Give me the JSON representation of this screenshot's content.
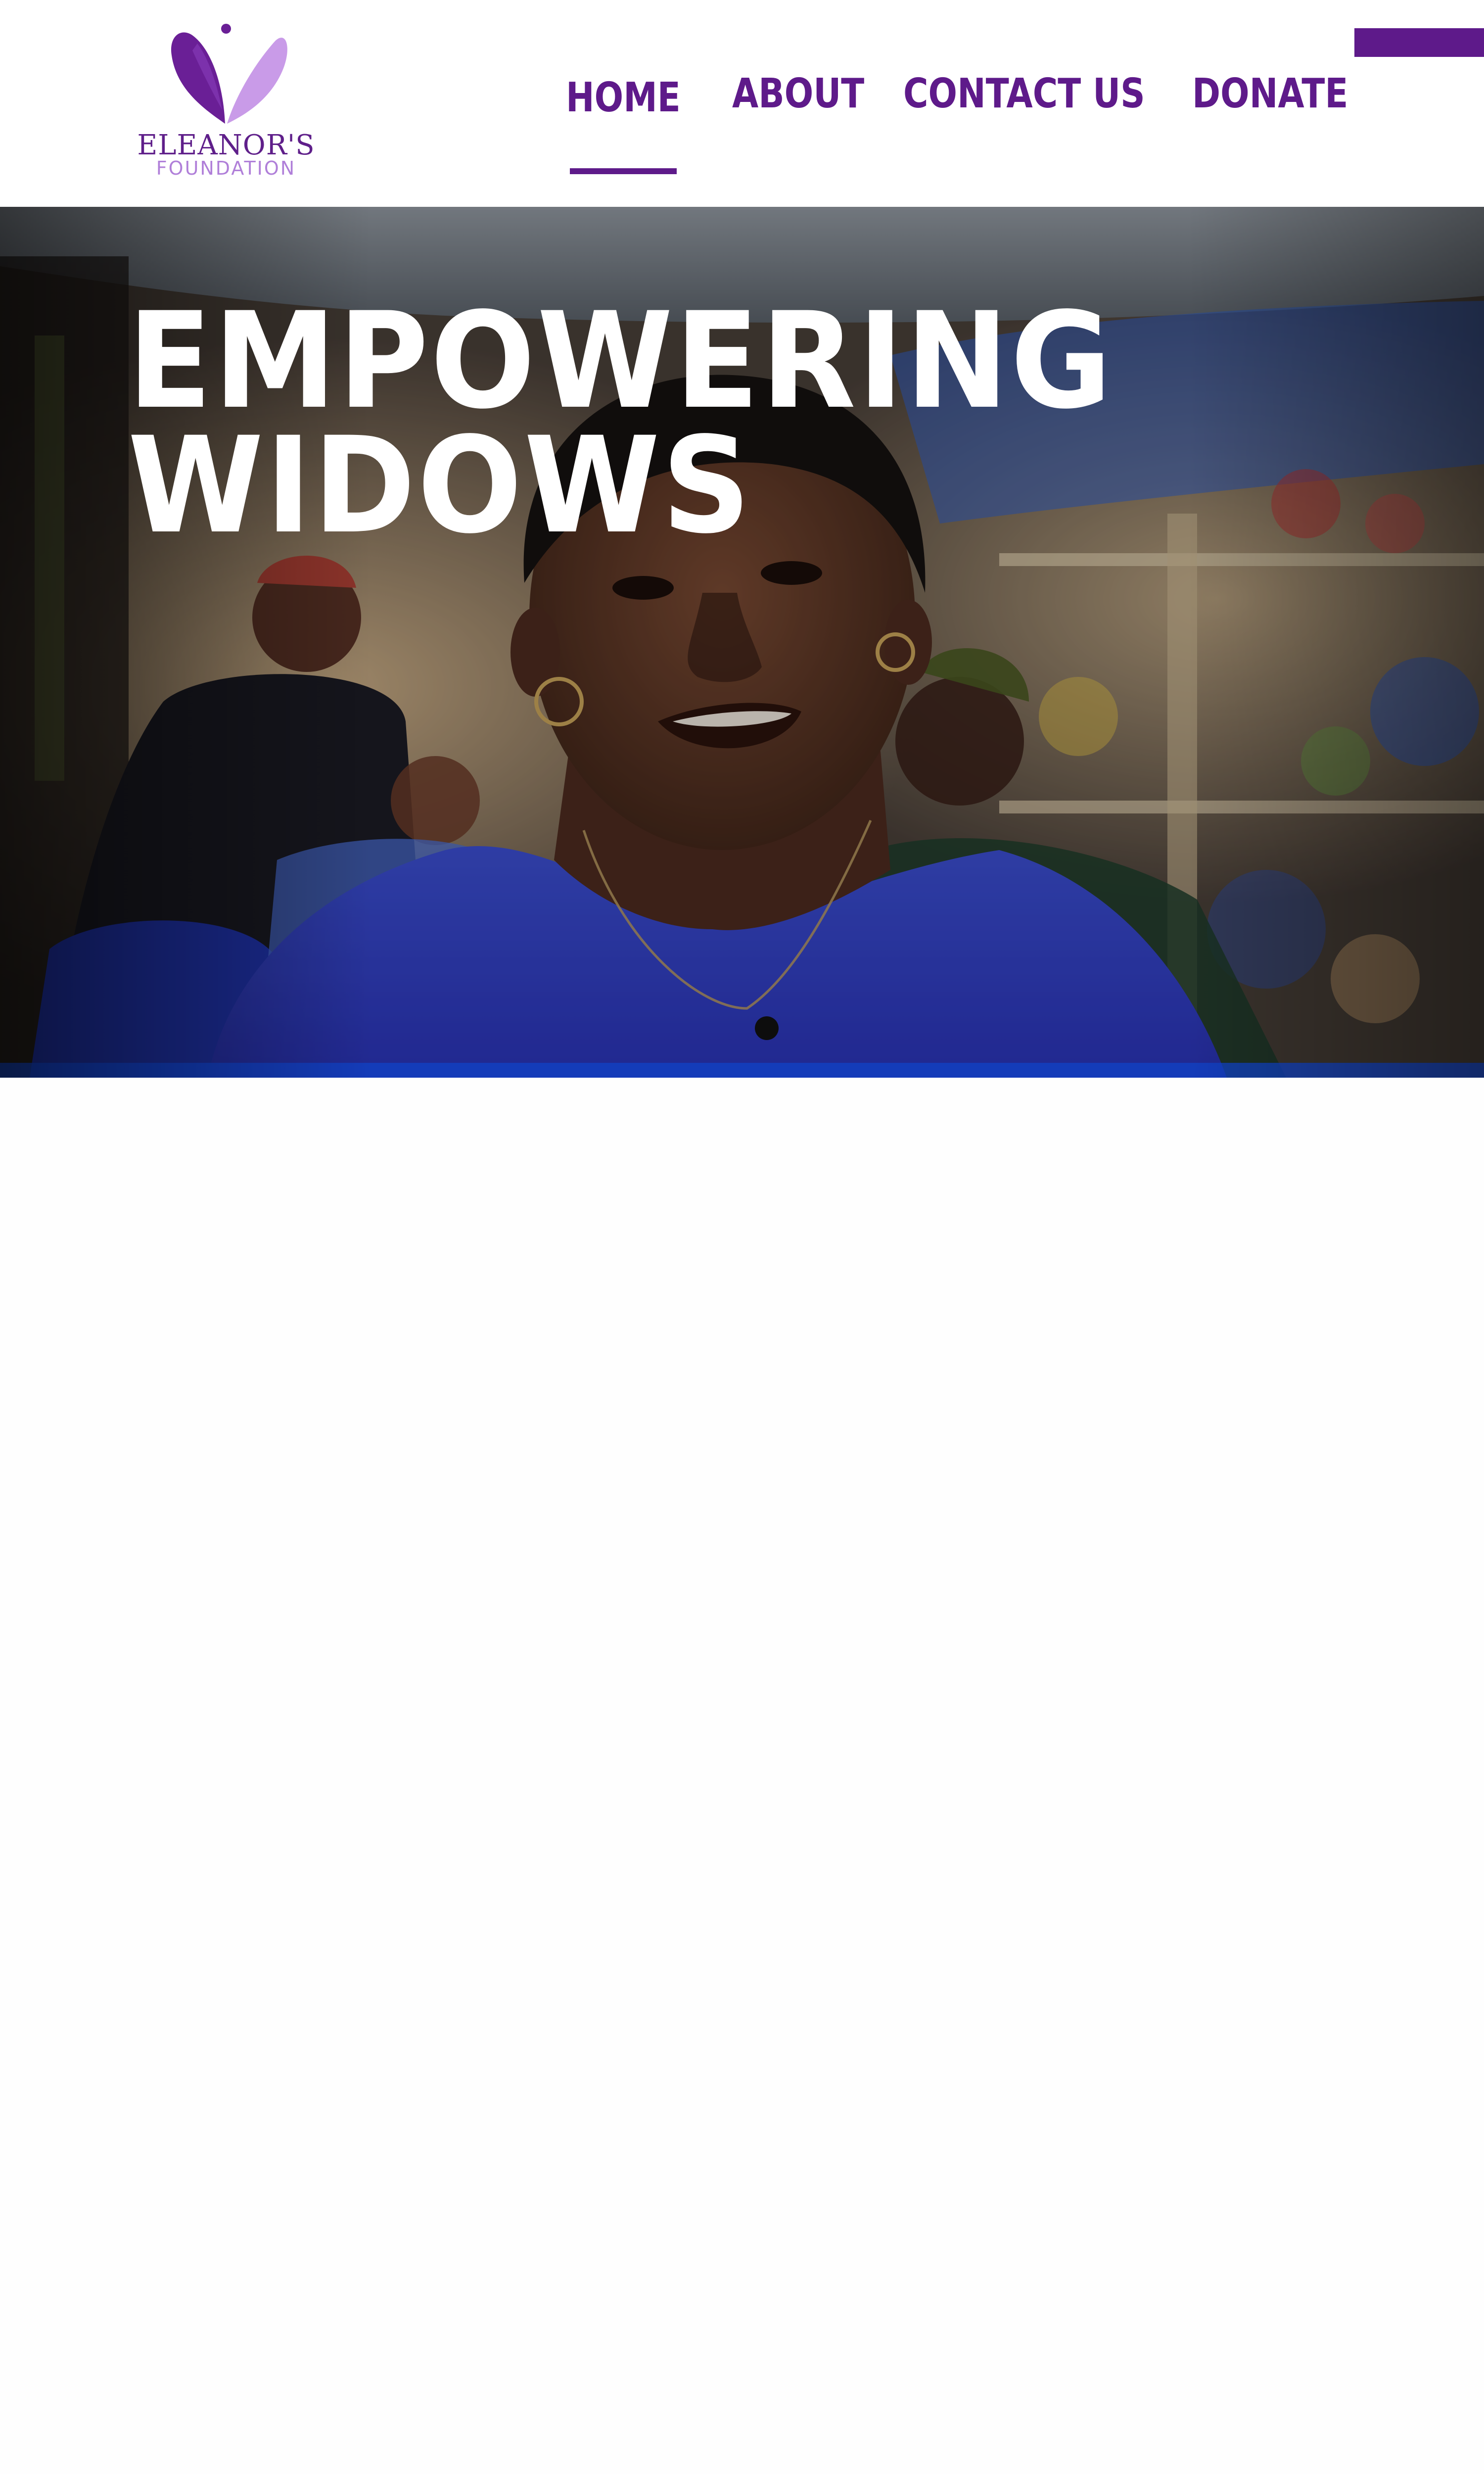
{
  "brand": {
    "name": "ELEANOR'S",
    "sub": "FOUNDATION",
    "primary_color": "#5e1a8a",
    "light_color": "#c99be8",
    "logo_icon": "heart-leaves-icon"
  },
  "nav": {
    "items": [
      {
        "label": "HOME",
        "active": true
      },
      {
        "label": "ABOUT",
        "active": false
      },
      {
        "label": "CONTACT US",
        "active": false
      },
      {
        "label": "DONATE",
        "active": false
      }
    ]
  },
  "hero": {
    "title_line1": "EMPOWERING",
    "title_line2": "WIDOWS",
    "image": "smiling woman in blue top at an outdoor market stall",
    "title_color": "#ffffff"
  }
}
